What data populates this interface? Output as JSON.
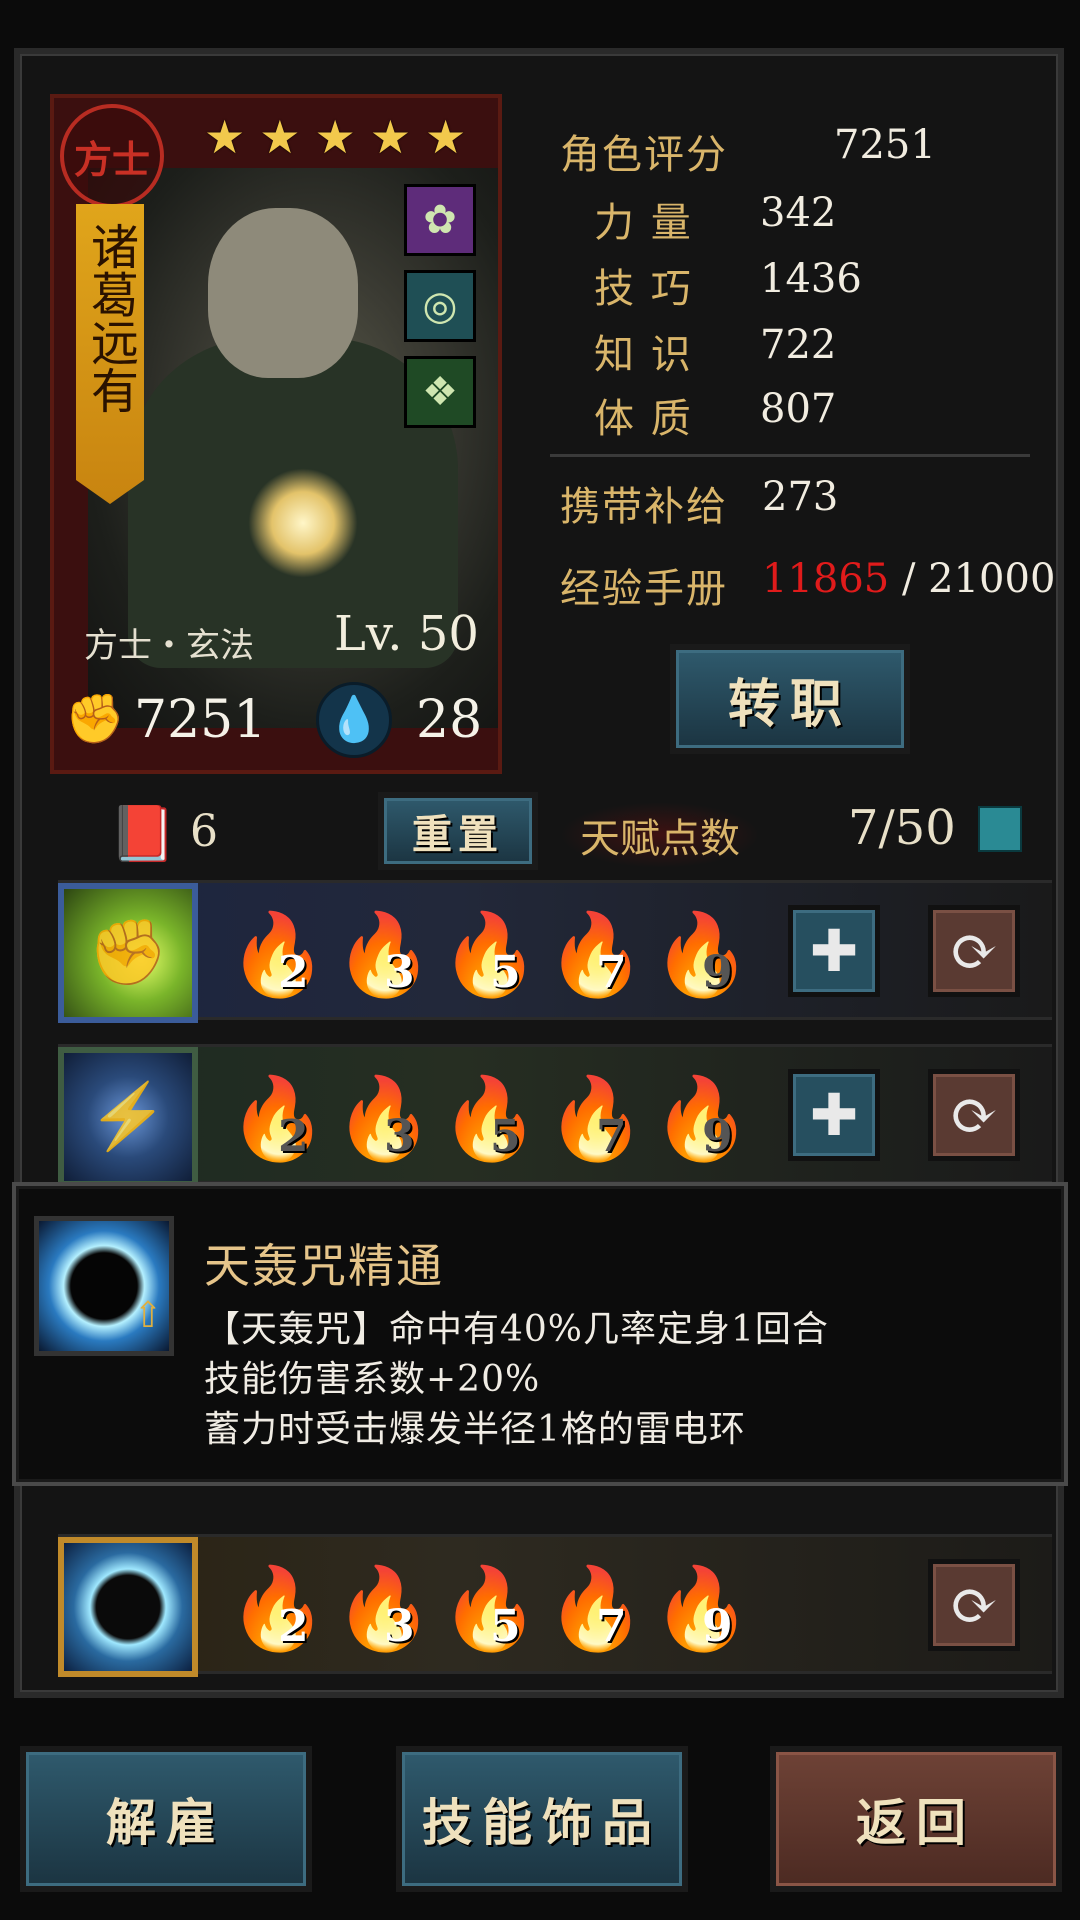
{
  "hero": {
    "class_seal": "方士",
    "name": "诸葛远有",
    "stars": [
      "★",
      "★",
      "★",
      "★",
      "★"
    ],
    "class_line": "方士・玄法",
    "level": "Lv. 50",
    "power": "7251",
    "stress_or_supply_icon_value": "28",
    "trinkets": [
      {
        "icon": "green-orb-trinket-icon"
      },
      {
        "icon": "teal-ring-trinket-icon"
      },
      {
        "icon": "jade-talisman-trinket-icon"
      }
    ]
  },
  "stats": {
    "score_label": "角色评分",
    "score_value": "7251",
    "strength_label": "力 量",
    "strength_value": "342",
    "skill_label": "技 巧",
    "skill_value": "1436",
    "knowledge_label": "知 识",
    "knowledge_value": "722",
    "constitution_label": "体 质",
    "constitution_value": "807",
    "supplies_label": "携带补给",
    "supplies_value": "273",
    "exp_label": "经验手册",
    "exp_current": "11865",
    "exp_sep": " / ",
    "exp_max": "21000"
  },
  "buttons": {
    "change_class": "转职",
    "reset": "重置",
    "dismiss": "解雇",
    "skills_trinkets": "技能饰品",
    "back": "返回"
  },
  "talent": {
    "book_count": "6",
    "label": "天赋点数",
    "value": "7/50"
  },
  "skill_rows": [
    {
      "ranks": [
        "2",
        "3",
        "5",
        "7",
        "9"
      ],
      "unlocked": 4
    },
    {
      "ranks": [
        "2",
        "3",
        "5",
        "7",
        "9"
      ],
      "unlocked": 0
    },
    {
      "ranks": [
        "2",
        "3",
        "5",
        "7",
        "9"
      ],
      "unlocked": 5
    }
  ],
  "tooltip": {
    "title": "天轰咒精通",
    "lines": [
      "【天轰咒】命中有40%几率定身1回合",
      "技能伤害系数+20%",
      "蓄力时受击爆发半径1格的雷电环"
    ]
  }
}
